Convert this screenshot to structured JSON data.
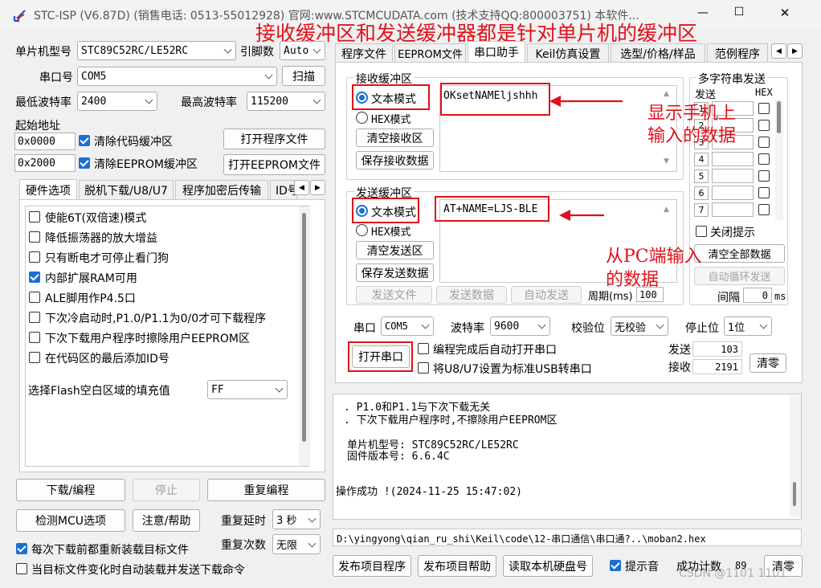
{
  "window": {
    "title": "STC-ISP (V6.87D) (销售电话: 0513-55012928) 官网:www.STCMCUDATA.com  (技术支持QQ:800003751) 本软件...",
    "minimize": "—",
    "maximize": "☐",
    "close": "✕"
  },
  "annotations": {
    "top": "接收缓冲区和发送缓冲器都是针对单片机的缓冲区",
    "recv_line1": "显示手机上",
    "recv_line2": "输入的数据",
    "send_line1": "从PC端输入",
    "send_line2": "的数据",
    "accent_color": "#e0101a"
  },
  "left": {
    "mcu_label": "单片机型号",
    "mcu_value": "STC89C52RC/LE52RC",
    "pin_label": "引脚数",
    "pin_value": "Auto",
    "port_label": "串口号",
    "port_value": "COM5",
    "scan": "扫描",
    "minbaud_label": "最低波特率",
    "minbaud_value": "2400",
    "maxbaud_label": "最高波特率",
    "maxbaud_value": "115200",
    "start_label": "起始地址",
    "addr1": "0x0000",
    "clear_code": "清除代码缓冲区",
    "open_prog": "打开程序文件",
    "addr2": "0x2000",
    "clear_eeprom": "清除EEPROM缓冲区",
    "open_eeprom": "打开EEPROM文件",
    "tabs": [
      "硬件选项",
      "脱机下载/U8/U7",
      "程序加密后传输",
      "ID号"
    ],
    "options": [
      {
        "label": "使能6T(双倍速)模式",
        "checked": false
      },
      {
        "label": "降低振荡器的放大增益",
        "checked": false
      },
      {
        "label": "只有断电才可停止看门狗",
        "checked": false
      },
      {
        "label": "内部扩展RAM可用",
        "checked": true
      },
      {
        "label": "ALE脚用作P4.5口",
        "checked": false
      },
      {
        "label": "下次冷启动时,P1.0/P1.1为0/0才可下载程序",
        "checked": false
      },
      {
        "label": "下次下载用户程序时擦除用户EEPROM区",
        "checked": false
      },
      {
        "label": "在代码区的最后添加ID号",
        "checked": false
      }
    ],
    "fill_label": "选择Flash空白区域的填充值",
    "fill_value": "FF",
    "download": "下载/编程",
    "stop": "停止",
    "reprogram": "重复编程",
    "check_mcu": "检测MCU选项",
    "help": "注意/帮助",
    "delay_label": "重复延时",
    "delay_value": "3 秒",
    "count_label": "重复次数",
    "count_value": "无限",
    "reload_label": "每次下载前都重新装载目标文件",
    "autoload_label": "当目标文件变化时自动装载并发送下载命令"
  },
  "right": {
    "tabs": [
      "程序文件",
      "EEPROM文件",
      "串口助手",
      "Keil仿真设置",
      "选型/价格/样品",
      "范例程序"
    ],
    "recv_group": "接收缓冲区",
    "recv_text_mode": "文本模式",
    "recv_hex_mode": "HEX模式",
    "clear_recv": "清空接收区",
    "save_recv": "保存接收数据",
    "recv_content": "OKsetNAMEljshhh",
    "send_group": "发送缓冲区",
    "send_text_mode": "文本模式",
    "send_hex_mode": "HEX模式",
    "clear_send": "清空发送区",
    "save_send": "保存发送数据",
    "send_content": "AT+NAME=LJS-BLE",
    "send_file": "发送文件",
    "send_data": "发送数据",
    "auto_send": "自动发送",
    "period_label": "周期(ms)",
    "period_value": "100",
    "multi_group": "多字符串发送",
    "multi_send_col": "发送",
    "multi_hex_col": "HEX",
    "multi_rows": [
      "1",
      "2",
      "3",
      "4",
      "5",
      "6",
      "7"
    ],
    "close_tip": "关闭提示",
    "clear_all": "清空全部数据",
    "loop_send": "自动循环发送",
    "interval_label": "间隔",
    "interval_value": "0",
    "interval_unit": "ms",
    "port_label": "串口",
    "port_value": "COM5",
    "baud_label": "波特率",
    "baud_value": "9600",
    "parity_label": "校验位",
    "parity_value": "无校验",
    "stop_label": "停止位",
    "stop_value": "1位",
    "open_port": "打开串口",
    "auto_open": "编程完成后自动打开串口",
    "usb_label": "将U8/U7设置为标准USB转串口",
    "sent_label": "发送",
    "sent_value": "103",
    "recv_label": "接收",
    "recv_value": "2191",
    "clear_count": "清零"
  },
  "log": {
    "lines": [
      ". P1.0和P1.1与下次下载无关",
      ". 下次下载用户程序时,不擦除用户EEPROM区",
      "",
      "单片机型号: STC89C52RC/LE52RC",
      "固件版本号: 6.6.4C",
      "",
      "",
      "操作成功 !(2024-11-25 15:47:02)"
    ],
    "path": "D:\\yingyong\\qian_ru_shi\\Keil\\code\\12-串口通信\\串口通?..\\moban2.hex"
  },
  "bottom": {
    "publish_prog": "发布项目程序",
    "publish_help": "发布项目帮助",
    "read_disk": "读取本机硬盘号",
    "beep_label": "提示音",
    "success_label": "成功计数",
    "success_value": "89",
    "clear": "清零",
    "watermark": "CSDN @1101 1101"
  }
}
